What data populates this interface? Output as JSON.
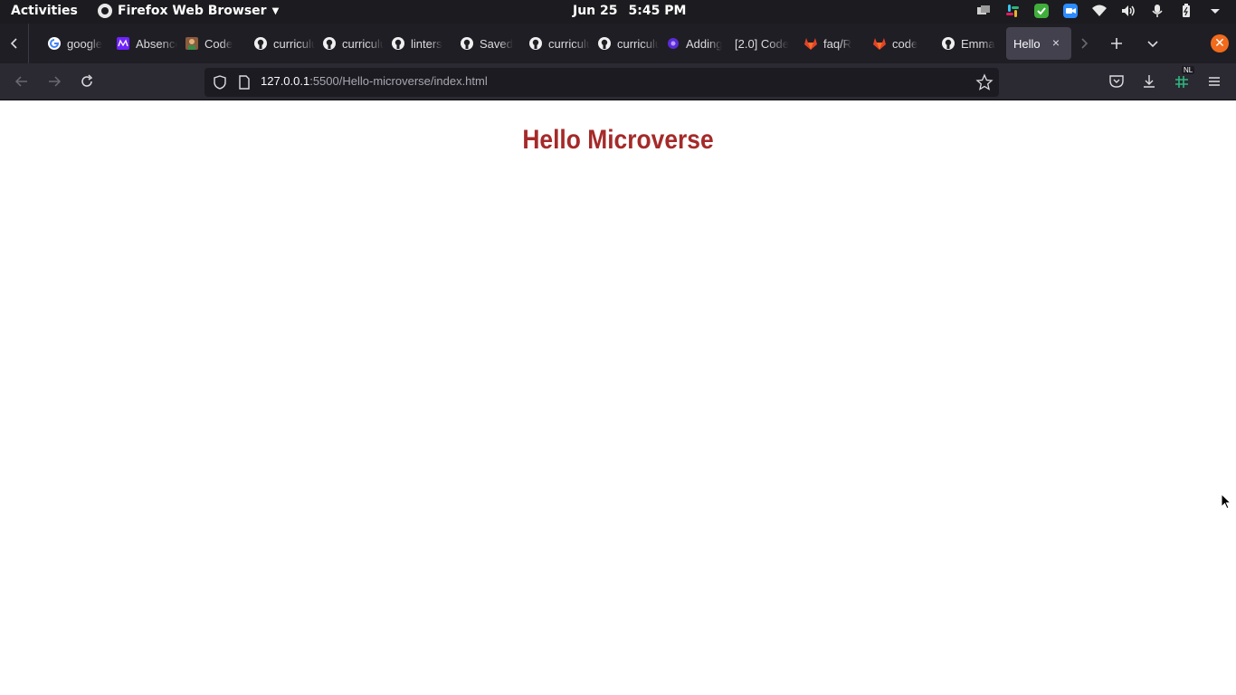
{
  "topbar": {
    "activities": "Activities",
    "app_name": "Firefox Web Browser",
    "date": "Jun 25",
    "time": "5:45 PM"
  },
  "tabs": [
    {
      "label": "google",
      "icon": "google-icon"
    },
    {
      "label": "Absences",
      "icon": "microverse-icon"
    },
    {
      "label": "Code",
      "icon": "avatar-icon"
    },
    {
      "label": "curriculum",
      "icon": "github-icon"
    },
    {
      "label": "curriculum",
      "icon": "github-icon"
    },
    {
      "label": "linters",
      "icon": "github-icon"
    },
    {
      "label": "Saved",
      "icon": "github-icon"
    },
    {
      "label": "curriculum",
      "icon": "github-icon"
    },
    {
      "label": "curriculum",
      "icon": "github-icon"
    },
    {
      "label": "Adding",
      "icon": "purple-dot-icon"
    },
    {
      "label": "[2.0] Code",
      "icon": ""
    },
    {
      "label": "faq/R",
      "icon": "gitlab-icon"
    },
    {
      "label": "code",
      "icon": "gitlab-icon"
    },
    {
      "label": "Emma",
      "icon": "github-icon"
    }
  ],
  "active_tab": {
    "label": "Hello"
  },
  "navbar": {
    "url_host": "127.0.0.1",
    "url_path": ":5500/Hello-microverse/index.html",
    "extension_badge": "NL"
  },
  "page": {
    "heading": "Hello Microverse"
  },
  "colors": {
    "heading": "#a52a2a",
    "topbar_bg": "#1c1b1f",
    "tabstrip_bg": "#1f1e24",
    "navbar_bg": "#2b2a33",
    "firefox_close": "#f26b1d"
  }
}
